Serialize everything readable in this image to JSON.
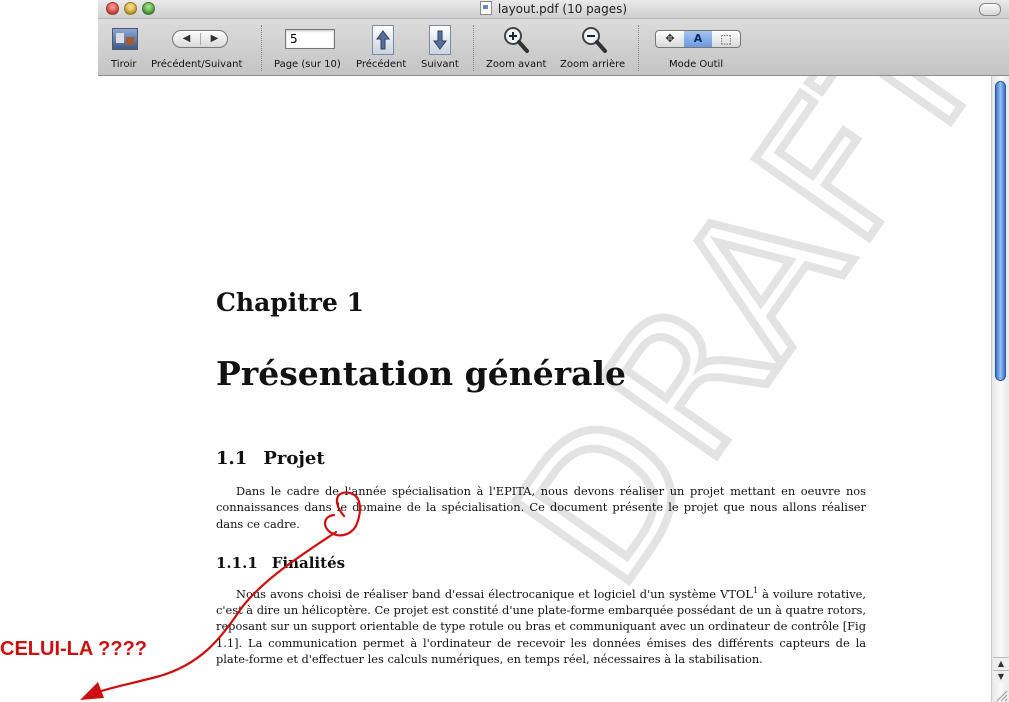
{
  "window": {
    "title": "layout.pdf (10 pages)"
  },
  "toolbar": {
    "drawer_label": "Tiroir",
    "prevnext_label": "Précédent/Suivant",
    "page_value": "5",
    "page_label": "Page (sur 10)",
    "previous_label": "Précédent",
    "next_label": "Suivant",
    "zoom_in_label": "Zoom avant",
    "zoom_out_label": "Zoom arrière",
    "mode_label": "Mode Outil",
    "mode_options": [
      "move",
      "text",
      "select"
    ],
    "mode_selected": "text",
    "mode_text_glyph": "A"
  },
  "document": {
    "chapter": "Chapitre 1",
    "chapter_title": "Présentation générale",
    "section_number": "1.1",
    "section_title": "Projet",
    "section_para": "Dans le cadre de l'année spécialisation à l'EPITA, nous devons réaliser un projet mettant en oeuvre nos connaissances dans le domaine de la spécialisation. Ce document présente le projet que nous allons réaliser dans ce cadre.",
    "subsection_number": "1.1.1",
    "subsection_title": "Finalités",
    "subsection_para_1": "Nous avons choisi de réaliser band d'essai électrocanique et logiciel d'un système VTOL",
    "footnote_mark": "1",
    "subsection_para_2": " à voilure rotative, c'est à dire un hélicoptère. Ce projet est constité d'une plate-forme embarquée possédant de un à quatre rotors, reposant sur un support orientable de type rotule ou bras et communiquant avec un ordinateur de contrôle [Fig 1.1]. La communication permet à l'ordinateur de recevoir les données émises des différents capteurs de la plate-forme et d'effectuer les calculs numériques, en temps réel, nécessaires à la stabilisation.",
    "watermark_text": "DRAFT"
  },
  "annotation": {
    "text": "CELUI-LA ????",
    "color": "#cc1010"
  },
  "colors": {
    "scroll_thumb": "#3a73c9",
    "mode_active": "#6b9ae0"
  }
}
